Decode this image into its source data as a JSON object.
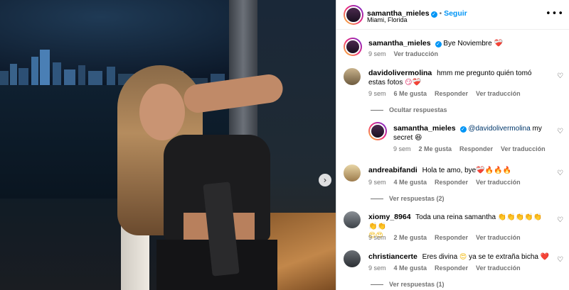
{
  "post": {
    "next_icon": "chevron-right-icon"
  },
  "header": {
    "username": "samantha_mieles",
    "follow_label": "Seguir",
    "location": "Miami, Florida",
    "more_icon": "ellipsis-icon"
  },
  "caption": {
    "username": "samantha_mieles",
    "text": "Bye Noviembre",
    "emoji": "❤️‍🩹",
    "age": "9 sem",
    "translate": "Ver traducción"
  },
  "comments": [
    {
      "username": "davidolivermolina",
      "text": "hmm me pregunto quién tomó estas fotos",
      "emoji": "😏❤️‍🩹",
      "age": "9 sem",
      "likes": "6 Me gusta",
      "reply": "Responder",
      "translate": "Ver traducción",
      "hide_replies": "Ocultar respuestas"
    },
    {
      "username": "samantha_mieles",
      "mention": "@davidolivermolina",
      "text": "my secret",
      "emoji": "😆",
      "age": "9 sem",
      "likes": "2 Me gusta",
      "reply": "Responder",
      "translate": "Ver traducción"
    },
    {
      "username": "andreabifandi",
      "text": "Hola te amo, bye",
      "emoji": "❤️‍🩹🔥🔥🔥",
      "age": "9 sem",
      "likes": "4 Me gusta",
      "reply": "Responder",
      "translate": "Ver traducción",
      "view_replies": "Ver respuestas (2)"
    },
    {
      "username": "xiomy_8964",
      "text": "Toda una reina samantha",
      "emoji": "👏👏👏👏👏👏👏",
      "emoji2": "😍😍",
      "age": "9 sem",
      "likes": "2 Me gusta",
      "reply": "Responder",
      "translate": "Ver traducción"
    },
    {
      "username": "christiancerte",
      "text": "Eres divina",
      "emoji": "😍",
      "text2": "ya se te extraña bicha",
      "emoji2": "❤️",
      "age": "9 sem",
      "likes": "4 Me gusta",
      "reply": "Responder",
      "translate": "Ver traducción",
      "view_replies": "Ver respuestas (1)"
    }
  ]
}
